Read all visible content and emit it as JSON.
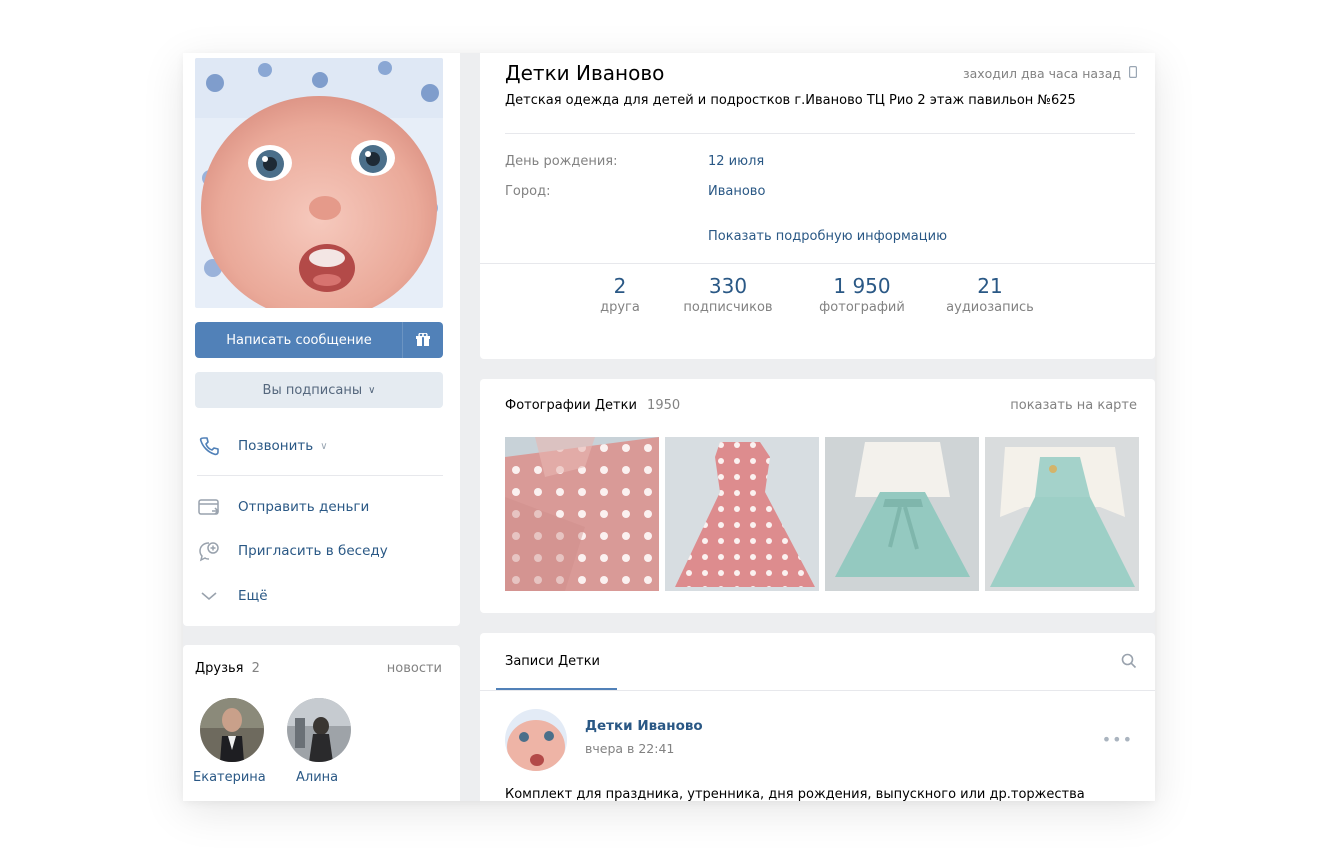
{
  "profile": {
    "name": "Детки Иваново",
    "last_seen": "заходил два часа назад",
    "status": "Детская одежда для детей и подростков г.Иваново ТЦ Рио 2 этаж павильон №625",
    "birthday_label": "День рождения:",
    "birthday_value": "12 июля",
    "city_label": "Город:",
    "city_value": "Иваново",
    "show_more": "Показать подробную информацию"
  },
  "counters": [
    {
      "num": "2",
      "label": "друга"
    },
    {
      "num": "330",
      "label": "подписчиков"
    },
    {
      "num": "1 950",
      "label": "фотографий"
    },
    {
      "num": "21",
      "label": "аудиозапись"
    }
  ],
  "actions": {
    "message": "Написать сообщение",
    "subscribed": "Вы подписаны",
    "call": "Позвонить",
    "send_money": "Отправить деньги",
    "invite_chat": "Пригласить в беседу",
    "more": "Ещё"
  },
  "photos": {
    "title": "Фотографии Детки",
    "count": "1950",
    "map_link": "показать на карте"
  },
  "friends": {
    "title": "Друзья",
    "count": "2",
    "news_link": "новости",
    "items": [
      {
        "name": "Екатерина"
      },
      {
        "name": "Алина"
      }
    ]
  },
  "wall": {
    "tab": "Записи Детки",
    "post": {
      "author": "Детки Иваново",
      "time": "вчера в 22:41",
      "text": "Комплект для праздника, утренника, дня рождения, выпускного или др.торжества"
    }
  },
  "colors": {
    "accent": "#5181b8",
    "link": "#2a5885",
    "background": "#edeef0"
  }
}
